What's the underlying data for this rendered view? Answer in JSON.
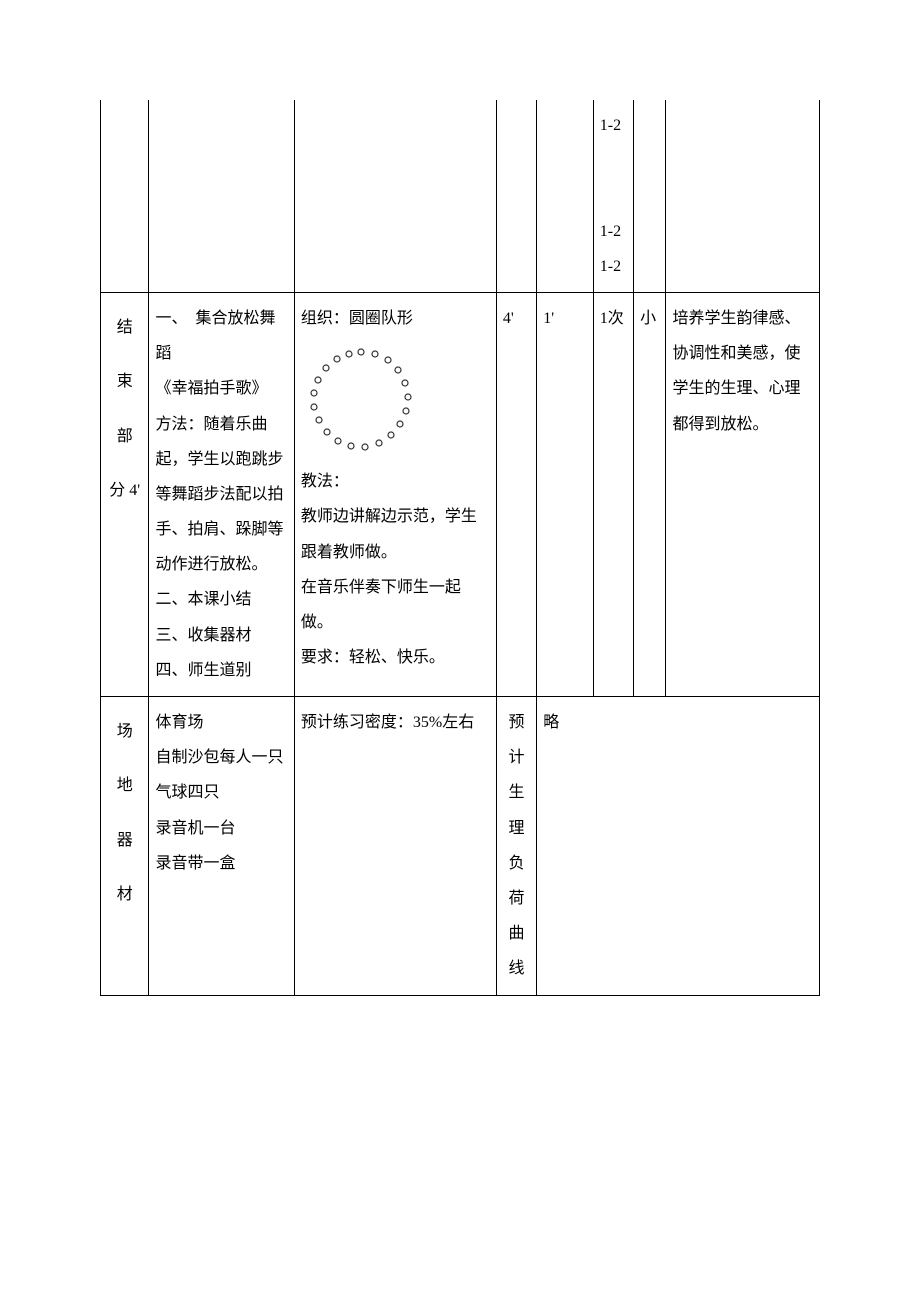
{
  "row1": {
    "c6": "1-2\n\n\n1-2\n1-2"
  },
  "row2": {
    "label": "结束部分 4'",
    "c2": "一、　集合放松舞蹈\n《幸福拍手歌》\n方法：随着乐曲起，学生以跑跳步等舞蹈步法配以拍手、拍肩、跺脚等动作进行放松。\n二、本课小结\n三、收集器材\n四、师生道别",
    "c3_a": "组织：圆圈队形",
    "c3_b": "教法：\n教师边讲解边示范，学生跟着教师做。\n在音乐伴奏下师生一起做。\n要求：轻松、快乐。",
    "c4": "4'",
    "c5": "1'",
    "c6": "1次",
    "c7": "小",
    "c8": "培养学生韵律感、协调性和美感，使学生的生理、心理都得到放松。"
  },
  "row3": {
    "label": "场地器材",
    "c2": "体育场\n自制沙包每人一只\n气球四只\n录音机一台\n录音带一盒",
    "c3": "预计练习密度：35%左右",
    "c4label": "预计生理负荷曲线",
    "c5": "略"
  }
}
